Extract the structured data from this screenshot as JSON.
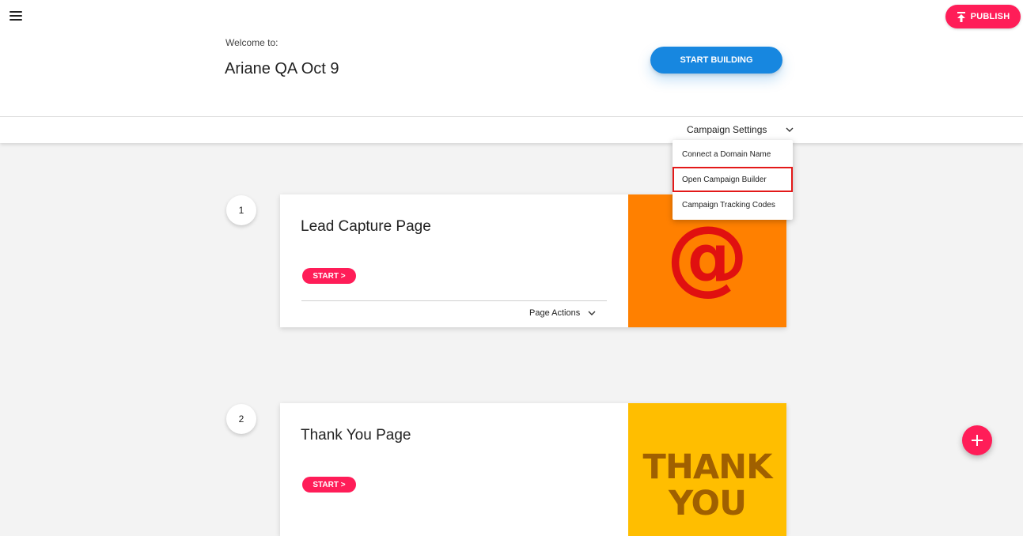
{
  "header": {
    "publish_label": "PUBLISH",
    "welcome_label": "Welcome to:",
    "campaign_name": "Ariane QA Oct 9",
    "start_building_label": "START BUILDING"
  },
  "settings": {
    "toggle_label": "Campaign Settings",
    "menu_items": [
      {
        "label": "Connect a Domain Name"
      },
      {
        "label": "Open Campaign Builder"
      },
      {
        "label": "Campaign Tracking Codes"
      }
    ]
  },
  "pages": [
    {
      "step": "1",
      "title": "Lead Capture Page",
      "start_label": "START >",
      "actions_label": "Page Actions",
      "thumbnail_text": "@",
      "thumbnail_color": "#ff8000"
    },
    {
      "step": "2",
      "title": "Thank You Page",
      "start_label": "START >",
      "thumbnail_text": "THANK YOU",
      "thumbnail_color": "#ffbe00"
    }
  ],
  "colors": {
    "accent": "#ff1d58",
    "primary": "#1787e0",
    "highlight": "#e31919"
  },
  "icons": [
    "menu-icon",
    "upload-icon",
    "chevron-down-icon",
    "plus-icon"
  ]
}
